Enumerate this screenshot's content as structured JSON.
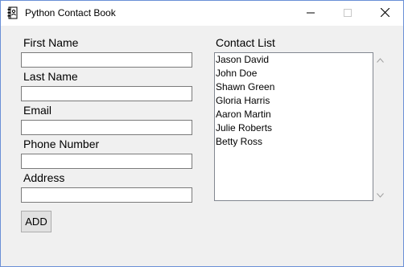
{
  "window": {
    "title": "Python Contact Book",
    "accent_color": "#6a8fd6"
  },
  "form": {
    "first_name_label": "First Name",
    "first_name_value": "",
    "last_name_label": "Last Name",
    "last_name_value": "",
    "email_label": "Email",
    "email_value": "",
    "phone_label": "Phone Number",
    "phone_value": "",
    "address_label": "Address",
    "address_value": "",
    "add_button_label": "ADD"
  },
  "contacts": {
    "label": "Contact List",
    "items": [
      "Jason David",
      "John Doe",
      "Shawn Green",
      "Gloria Harris",
      "Aaron Martin",
      "Julie Roberts",
      "Betty Ross"
    ]
  },
  "icons": {
    "app": "address-book-icon",
    "minimize": "minimize-icon",
    "maximize": "maximize-icon",
    "close": "close-icon",
    "scroll_up": "chevron-up-icon",
    "scroll_down": "chevron-down-icon"
  }
}
